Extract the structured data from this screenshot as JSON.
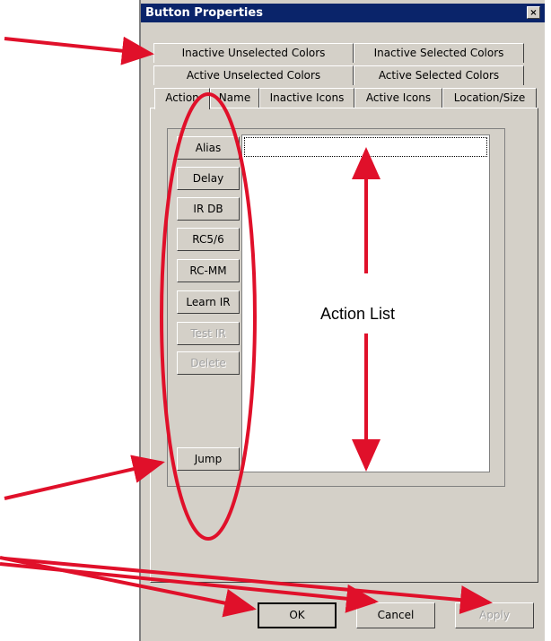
{
  "dialog": {
    "title": "Button Properties",
    "close_glyph": "×"
  },
  "tabs": {
    "row1": [
      "Inactive Unselected Colors",
      "Inactive Selected Colors"
    ],
    "row2": [
      "Active Unselected Colors",
      "Active Selected Colors"
    ],
    "row3": [
      "Action",
      "Name",
      "Inactive Icons",
      "Active Icons",
      "Location/Size"
    ],
    "active": "Action"
  },
  "action_buttons": [
    {
      "label": "Alias",
      "enabled": true
    },
    {
      "label": "Delay",
      "enabled": true
    },
    {
      "label": "IR DB",
      "enabled": true
    },
    {
      "label": "RC5/6",
      "enabled": true
    },
    {
      "label": "RC-MM",
      "enabled": true
    },
    {
      "label": "Learn IR",
      "enabled": true
    },
    {
      "label": "Test IR",
      "enabled": false
    },
    {
      "label": "Delete",
      "enabled": false
    },
    {
      "label": "Jump",
      "enabled": true
    }
  ],
  "action_list": {
    "annotation_label": "Action List"
  },
  "footer": {
    "ok_label": "OK",
    "cancel_label": "Cancel",
    "apply_label": "Apply"
  },
  "colors": {
    "title_bar": "#0a246a",
    "dialog_face": "#d4d0c8",
    "annotation_red": "#e0102a"
  }
}
